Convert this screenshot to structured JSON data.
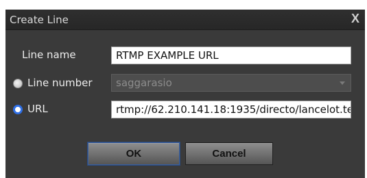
{
  "dialog": {
    "title": "Create Line",
    "close_symbol": "X"
  },
  "form": {
    "line_name_label": "Line name",
    "line_name_value": "RTMP EXAMPLE URL",
    "line_number_label": "Line number",
    "line_number_value": "saggarasio",
    "line_number_selected": false,
    "url_label": "URL",
    "url_value": "rtmp://62.210.141.18:1935/directo/lancelot.te",
    "url_selected": true
  },
  "buttons": {
    "ok_label": "OK",
    "cancel_label": "Cancel"
  },
  "colors": {
    "dialog_bg": "#3a3a3a",
    "titlebar_bg": "#2b2b2b",
    "radio_selected": "#2f6fe6",
    "button_focus": "#3b5f9a"
  }
}
